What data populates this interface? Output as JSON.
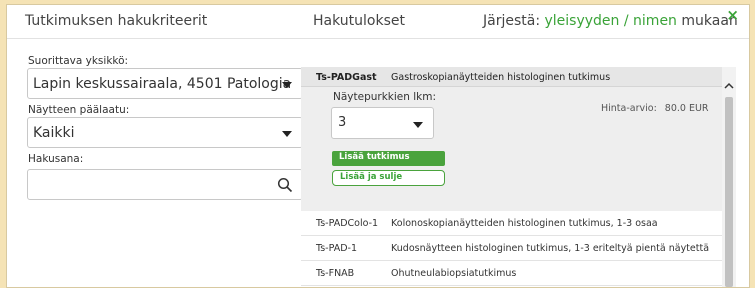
{
  "header": {
    "criteria_title": "Tutkimuksen hakukriteerit",
    "results_title": "Hakutulokset",
    "sort_prefix": "Järjestä:",
    "sort_relevance": "yleisyyden",
    "sort_sep": "/",
    "sort_name": "nimen",
    "sort_suffix": "mukaan",
    "close": "×"
  },
  "criteria": {
    "unit_label": "Suorittava yksikkö:",
    "unit_value": "Lapin keskussairaala, 4501 Patologia",
    "sample_label": "Näytteen päälaatu:",
    "sample_value": "Kaikki",
    "search_label": "Hakusana:",
    "search_value": ""
  },
  "results": {
    "selected": {
      "code": "Ts-PADGast",
      "name": "Gastroskopianäytteiden histologinen tutkimus",
      "count_label": "Näytepurkkien lkm:",
      "count_value": "3",
      "price_label": "Hinta-arvio:",
      "price_value": "80.0 EUR",
      "add_label": "Lisää tutkimus",
      "add_close_label": "Lisää ja sulje"
    },
    "rows": [
      {
        "code": "Ts-PADColo-1",
        "name": "Kolonoskopianäytteiden histologinen tutkimus, 1-3 osaa"
      },
      {
        "code": "Ts-PAD-1",
        "name": "Kudosnäytteen histologinen tutkimus, 1-3 eriteltyä pientä näytettä"
      },
      {
        "code": "Ts-FNAB",
        "name": "Ohutneulabiopsiatutkimus"
      }
    ]
  },
  "colors": {
    "accent_green": "#3aa338",
    "page_background": "#f5e3b5"
  }
}
